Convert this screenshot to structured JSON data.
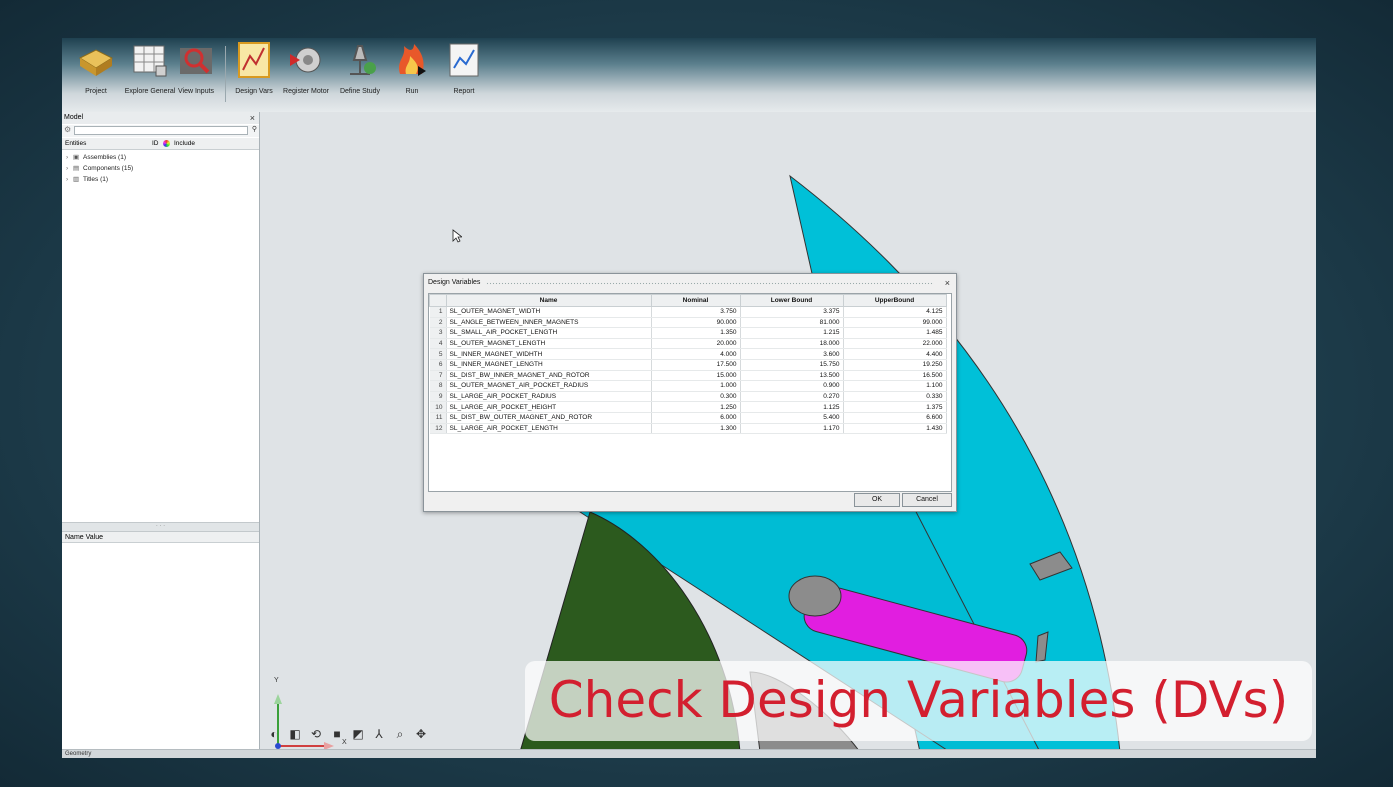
{
  "ribbon": {
    "items": [
      {
        "label": "Project",
        "icon": "project-icon"
      },
      {
        "label": "Explore General",
        "icon": "explore-general-icon"
      },
      {
        "label": "View Inputs",
        "icon": "view-inputs-icon"
      },
      {
        "label": "Design Vars",
        "icon": "design-vars-icon"
      },
      {
        "label": "Register Motor",
        "icon": "register-motor-icon"
      },
      {
        "label": "Define Study",
        "icon": "define-study-icon"
      },
      {
        "label": "Run",
        "icon": "run-icon"
      },
      {
        "label": "Report",
        "icon": "report-icon"
      }
    ]
  },
  "model_panel": {
    "title": "Model",
    "close": "×",
    "columns": {
      "entities": "Entities",
      "id": "ID",
      "include": "Include"
    },
    "tree": [
      {
        "label": "Assemblies (1)"
      },
      {
        "label": "Components (15)"
      },
      {
        "label": "Titles (1)"
      }
    ],
    "name_value_header": "Name Value"
  },
  "dialog": {
    "title": "Design Variables",
    "close": "×",
    "columns": [
      "Name",
      "Nominal",
      "Lower Bound",
      "UpperBound"
    ],
    "rows": [
      {
        "idx": "1",
        "name": "SL_OUTER_MAGNET_WIDTH",
        "nominal": "3.750",
        "lower": "3.375",
        "upper": "4.125"
      },
      {
        "idx": "2",
        "name": "SL_ANGLE_BETWEEN_INNER_MAGNETS",
        "nominal": "90.000",
        "lower": "81.000",
        "upper": "99.000"
      },
      {
        "idx": "3",
        "name": "SL_SMALL_AIR_POCKET_LENGTH",
        "nominal": "1.350",
        "lower": "1.215",
        "upper": "1.485"
      },
      {
        "idx": "4",
        "name": "SL_OUTER_MAGNET_LENGTH",
        "nominal": "20.000",
        "lower": "18.000",
        "upper": "22.000"
      },
      {
        "idx": "5",
        "name": "SL_INNER_MAGNET_WIDHTH",
        "nominal": "4.000",
        "lower": "3.600",
        "upper": "4.400"
      },
      {
        "idx": "6",
        "name": "SL_INNER_MAGNET_LENGTH",
        "nominal": "17.500",
        "lower": "15.750",
        "upper": "19.250"
      },
      {
        "idx": "7",
        "name": "SL_DIST_BW_INNER_MAGNET_AND_ROTOR",
        "nominal": "15.000",
        "lower": "13.500",
        "upper": "16.500"
      },
      {
        "idx": "8",
        "name": "SL_OUTER_MAGNET_AIR_POCKET_RADIUS",
        "nominal": "1.000",
        "lower": "0.900",
        "upper": "1.100"
      },
      {
        "idx": "9",
        "name": "SL_LARGE_AIR_POCKET_RADIUS",
        "nominal": "0.300",
        "lower": "0.270",
        "upper": "0.330"
      },
      {
        "idx": "10",
        "name": "SL_LARGE_AIR_POCKET_HEIGHT",
        "nominal": "1.250",
        "lower": "1.125",
        "upper": "1.375"
      },
      {
        "idx": "11",
        "name": "SL_DIST_BW_OUTER_MAGNET_AND_ROTOR",
        "nominal": "6.000",
        "lower": "5.400",
        "upper": "6.600"
      },
      {
        "idx": "12",
        "name": "SL_LARGE_AIR_POCKET_LENGTH",
        "nominal": "1.300",
        "lower": "1.170",
        "upper": "1.430"
      }
    ],
    "ok_label": "OK",
    "cancel_label": "Cancel"
  },
  "axes": {
    "y_label": "Y",
    "x_label": "X"
  },
  "status_bar": {
    "label": "Geometry"
  },
  "caption": "Check Design Variables (DVs)",
  "colors": {
    "stator": "#00c0d8",
    "magnet": "#e11ee0",
    "air_pocket": "#8c8c8c",
    "shaft": "#2c5a1e",
    "caption_text": "#d31f2f"
  }
}
